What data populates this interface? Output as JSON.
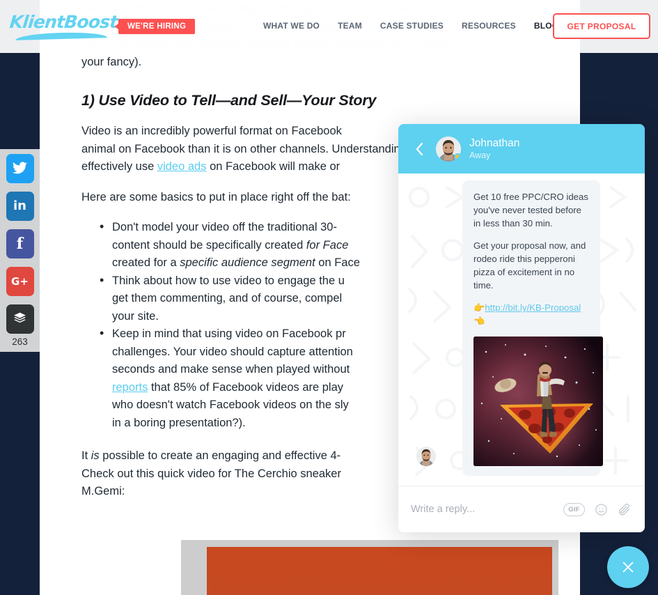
{
  "site": {
    "logo_text": "KlientBoost",
    "hiring_badge": "WE'RE HIRING",
    "nav": [
      {
        "label": "WHAT WE DO",
        "active": false
      },
      {
        "label": "TEAM",
        "active": false
      },
      {
        "label": "CASE STUDIES",
        "active": false
      },
      {
        "label": "RESOURCES",
        "active": false
      },
      {
        "label": "BLOG",
        "active": true
      }
    ],
    "cta_label": "GET PROPOSAL",
    "accent_red": "#fc5151",
    "accent_blue": "#5ed0f0",
    "sidebar_navy": "#14213a"
  },
  "share": {
    "items": [
      {
        "name": "twitter",
        "glyph": "t"
      },
      {
        "name": "linkedin",
        "glyph": "in"
      },
      {
        "name": "facebook",
        "glyph": "f"
      },
      {
        "name": "google-plus",
        "glyph": "G+"
      },
      {
        "name": "buffer",
        "glyph": "stack"
      }
    ],
    "count": "263"
  },
  "article": {
    "faded_paragraph_1": "interest in products. These strategies not only continue that level of",
    "faded_paragraph_2a": "interest, but also look at ways to move people down the ",
    "faded_link_1": "purchase",
    "faded_link_2": "funnel",
    "faded_paragraph_2b": " (or through the consumer decision journey, whichever term strikes",
    "paragraph_tail": "your fancy).",
    "heading": "1) Use Video to Tell—and Sell—Your Story",
    "para1_a": "Video is an incredibly powerful format on Facebook",
    "para1_b": "animal on Facebook than it is on other channels. Understanding how to",
    "para1_c": "effectively use ",
    "para1_link": "video ads",
    "para1_d": " on Facebook will make or",
    "para2": "Here are some basics to put in place right off the bat:",
    "bullets": [
      {
        "line1": "Don't model your video off the traditional 30-",
        "line2_a": "content should be specifically created ",
        "line2_em": "for Face",
        "line3_a": "created for a ",
        "line3_em": "specific audience segment",
        "line3_b": " on Face"
      },
      {
        "line1": "Think about how to use video to engage the u",
        "line2": "get them commenting, and of course, compel",
        "line3": "your site."
      },
      {
        "line1": "Keep in mind that using video on Facebook pr",
        "line2": "challenges. Your video should capture attention",
        "line3": "seconds and make sense when played without",
        "line4_link": "reports",
        "line4_b": " that 85% of Facebook videos are play",
        "line5": "who doesn't watch Facebook videos on the sly",
        "line6": "in a boring presentation?)."
      }
    ],
    "closing_a": "It ",
    "closing_em": "is",
    "closing_b": " possible to create an engaging and effective 4-",
    "closing_c": "Check out this quick video for The Cerchio sneaker",
    "closing_d": "M.Gemi:"
  },
  "chat": {
    "agent_name": "Johnathan",
    "agent_status": "Away",
    "message_p1": "Get 10 free PPC/CRO ideas you've never tested before in less than 30 min.",
    "message_p2": "Get your proposal now, and rodeo ride this pepperoni pizza of excitement in no time.",
    "link_emoji_left": "👉",
    "link_text": "http://bit.ly/KB-Proposal",
    "link_emoji_right": "👈",
    "image_alt": "cowboy riding a pepperoni pizza slice through space",
    "reply_placeholder": "Write a reply...",
    "gif_label": "GIF",
    "close_label": "×"
  }
}
